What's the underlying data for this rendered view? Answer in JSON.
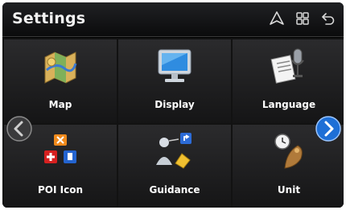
{
  "header": {
    "title": "Settings",
    "icons": [
      "navigation-icon",
      "grid-menu-icon",
      "back-icon"
    ]
  },
  "tiles": [
    {
      "label": "Map",
      "icon": "map-icon"
    },
    {
      "label": "Display",
      "icon": "display-icon"
    },
    {
      "label": "Language",
      "icon": "language-icon"
    },
    {
      "label": "POI Icon",
      "icon": "poi-icon"
    },
    {
      "label": "Guidance",
      "icon": "guidance-icon"
    },
    {
      "label": "Unit",
      "icon": "unit-icon"
    }
  ],
  "nav": {
    "prev": "chevron-left-icon",
    "next": "chevron-right-icon"
  },
  "colors": {
    "header_bg": "#151517",
    "tile_bg": "#222224",
    "accent_blue": "#1e6fd6"
  }
}
